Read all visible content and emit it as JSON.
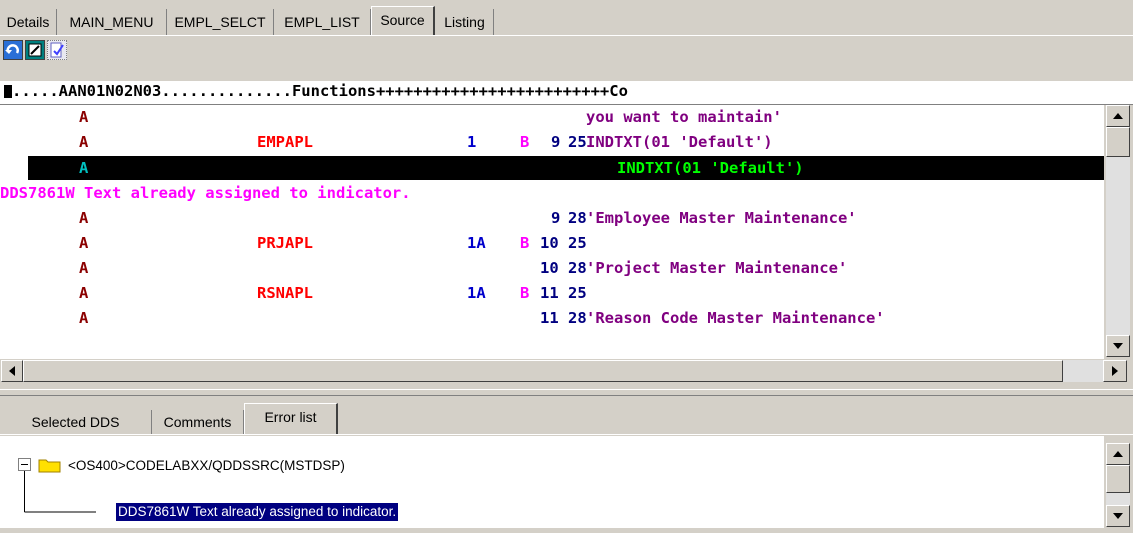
{
  "top_tabs": [
    "Details",
    "MAIN_MENU",
    "EMPL_SELCT",
    "EMPL_LIST",
    "Source",
    "Listing"
  ],
  "active_top_tab": "Source",
  "toolbar": {
    "icons": [
      "refresh-icon",
      "edit-icon",
      "check-icon"
    ]
  },
  "ruler": {
    "text": ".....AAN01N02N03..............Functions+++++++++++++++++++++++++Co"
  },
  "source_lines": [
    {
      "a": "A",
      "name": "",
      "len": "",
      "use": "",
      "row": "",
      "col": "",
      "func": "you want to maintain'"
    },
    {
      "a": "A",
      "name": "EMPAPL",
      "len": "1",
      "use": "B",
      "row": "9",
      "col": "25",
      "func": "INDTXT(01 'Default')"
    },
    {
      "a": "A",
      "name": "",
      "len": "",
      "use": "",
      "row": "",
      "col": "",
      "func": "INDTXT(01 'Default')"
    },
    {
      "message": "DDS7861W Text already assigned to indicator."
    },
    {
      "a": "A",
      "name": "",
      "len": "",
      "use": "",
      "row": "9",
      "col": "28",
      "func": "'Employee Master Maintenance'"
    },
    {
      "a": "A",
      "name": "PRJAPL",
      "len": "1A",
      "use": "B",
      "row": "10",
      "col": "25",
      "func": ""
    },
    {
      "a": "A",
      "name": "",
      "len": "",
      "use": "",
      "row": "10",
      "col": "28",
      "func": "'Project Master Maintenance'"
    },
    {
      "a": "A",
      "name": "RSNAPL",
      "len": "1A",
      "use": "B",
      "row": "11",
      "col": "25",
      "func": ""
    },
    {
      "a": "A",
      "name": "",
      "len": "",
      "use": "",
      "row": "11",
      "col": "28",
      "func": "'Reason Code Master Maintenance'"
    }
  ],
  "bottom_tabs": [
    "Selected DDS",
    "Comments",
    "Error list"
  ],
  "active_bottom_tab": "Error list",
  "error_list": {
    "source_member": "<OS400>CODELABXX/QDDSSRC(MSTDSP)",
    "message": "DDS7861W Text already assigned to indicator."
  },
  "colors": {
    "a_col": "#8b0000",
    "name": "#ff0000",
    "len": "#0000cc",
    "use": "#ff00ff",
    "pos": "#000080",
    "func": "#800080",
    "message": "#ff00ff",
    "sel_a": "#00c0c0",
    "sel_func": "#00ff00"
  }
}
